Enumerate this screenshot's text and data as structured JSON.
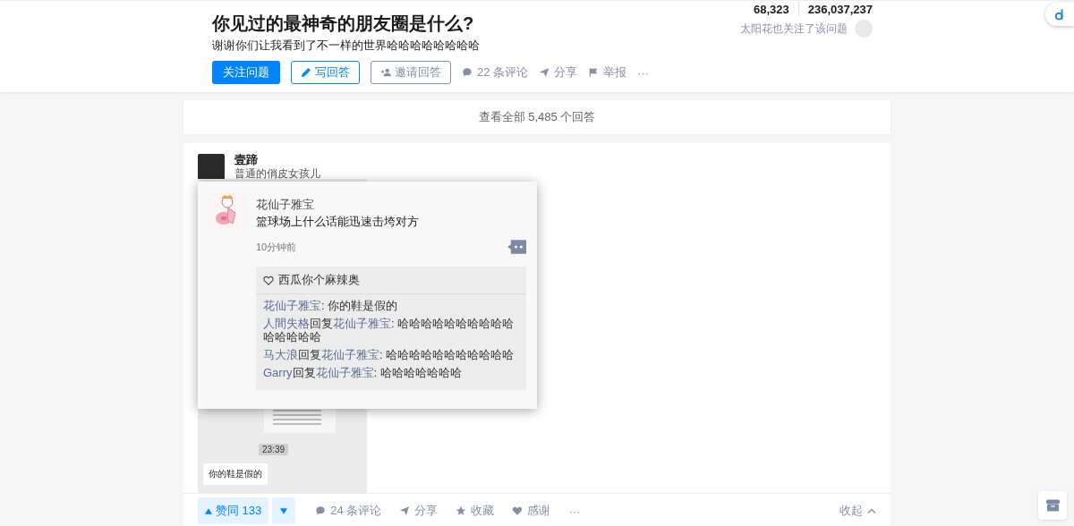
{
  "header": {
    "stats": [
      "68,323",
      "236,037,237"
    ],
    "title": "你见过的最神奇的朋友圈是什么?",
    "description": "谢谢你们让我看到了不一样的世界哈哈哈哈哈哈哈哈",
    "follower_note": "太阳花也关注了该问题",
    "buttons": [
      {
        "kind": "primary",
        "label": "关注问题"
      },
      {
        "kind": "write",
        "label": "写回答"
      },
      {
        "kind": "invite",
        "label": "邀请回答"
      }
    ],
    "actions": [
      {
        "kind": "comment",
        "label": "22 条评论"
      },
      {
        "kind": "share",
        "label": "分享"
      },
      {
        "kind": "report",
        "label": "举报"
      },
      {
        "kind": "more",
        "label": "···"
      }
    ]
  },
  "view_all": "查看全部 5,485 个回答",
  "answer": {
    "author": "壹蹄",
    "bio": "普通的俏皮女孩儿",
    "popup": {
      "name": "花仙子雅宝",
      "text": "篮球场上什么话能迅速击垮对方",
      "time": "10分钟前",
      "liked_by": "西瓜你个麻辣奥",
      "comments": [
        {
          "author": "花仙子雅宝",
          "text": ": 你的鞋是假的"
        },
        {
          "author": "人間失格",
          "reply": "回复",
          "reply_to": "花仙子雅宝",
          "text": ": 哈哈哈哈哈哈哈哈哈哈哈哈哈哈哈"
        },
        {
          "author": "马大浪",
          "reply": "回复",
          "reply_to": "花仙子雅宝",
          "text": ": 哈哈哈哈哈哈哈哈哈哈哈"
        },
        {
          "author": "Garry",
          "reply": "回复",
          "reply_to": "花仙子雅宝",
          "text": ": 哈哈哈哈哈哈哈"
        }
      ]
    },
    "chat_time": "23:39",
    "chat_bubble": "你的鞋是假的",
    "vote_up": "赞同 133",
    "actions": [
      {
        "kind": "comment",
        "label": "24 条评论"
      },
      {
        "kind": "share",
        "label": "分享"
      },
      {
        "kind": "favorite",
        "label": "收藏"
      },
      {
        "kind": "thanks",
        "label": "感谢"
      },
      {
        "kind": "more",
        "label": "···"
      }
    ],
    "collapse": "收起"
  }
}
